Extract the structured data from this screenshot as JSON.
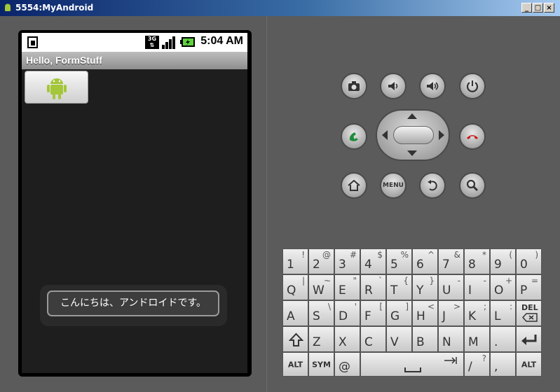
{
  "window": {
    "title": "5554:MyAndroid"
  },
  "statusbar": {
    "network": "3G",
    "time": "5:04 AM"
  },
  "app": {
    "title": "Hello, FormStuff"
  },
  "toast": {
    "message": "こんにちは、アンドロイドです。"
  },
  "controls": {
    "menu_label": "MENU"
  },
  "keyboard": {
    "row1": [
      [
        "1",
        "!"
      ],
      [
        "2",
        "@"
      ],
      [
        "3",
        "#"
      ],
      [
        "4",
        "$"
      ],
      [
        "5",
        "%"
      ],
      [
        "6",
        "^"
      ],
      [
        "7",
        "&"
      ],
      [
        "8",
        "*"
      ],
      [
        "9",
        "("
      ],
      [
        "0",
        ")"
      ]
    ],
    "row2": [
      [
        "Q",
        "|"
      ],
      [
        "W",
        "~"
      ],
      [
        "E",
        "\""
      ],
      [
        "R",
        "`"
      ],
      [
        "T",
        "{"
      ],
      [
        "Y",
        "}"
      ],
      [
        "U",
        "-"
      ],
      [
        "I",
        "-"
      ],
      [
        "O",
        "+"
      ],
      [
        "P",
        "="
      ]
    ],
    "row3": [
      [
        "A",
        ""
      ],
      [
        "S",
        "\\"
      ],
      [
        "D",
        "'"
      ],
      [
        "F",
        "["
      ],
      [
        "G",
        "]"
      ],
      [
        "H",
        "<"
      ],
      [
        "J",
        ">"
      ],
      [
        "K",
        ";"
      ],
      [
        "L",
        ":"
      ]
    ],
    "row4": [
      [
        "Z",
        ""
      ],
      [
        "X",
        ""
      ],
      [
        "C",
        ""
      ],
      [
        "V",
        ""
      ],
      [
        "B",
        ""
      ],
      [
        "N",
        ""
      ],
      [
        "M",
        ""
      ],
      [
        ".",
        ""
      ]
    ],
    "row5": {
      "alt_left": "ALT",
      "sym": "SYM",
      "at": "@",
      "slash": "/",
      "question": "?",
      "comma": ",",
      "alt_right": "ALT"
    },
    "del_label": "DEL"
  },
  "colors": {
    "call_green": "#1c8c3c",
    "end_red": "#c81e1e",
    "screen_bg": "#1e1e1e"
  }
}
